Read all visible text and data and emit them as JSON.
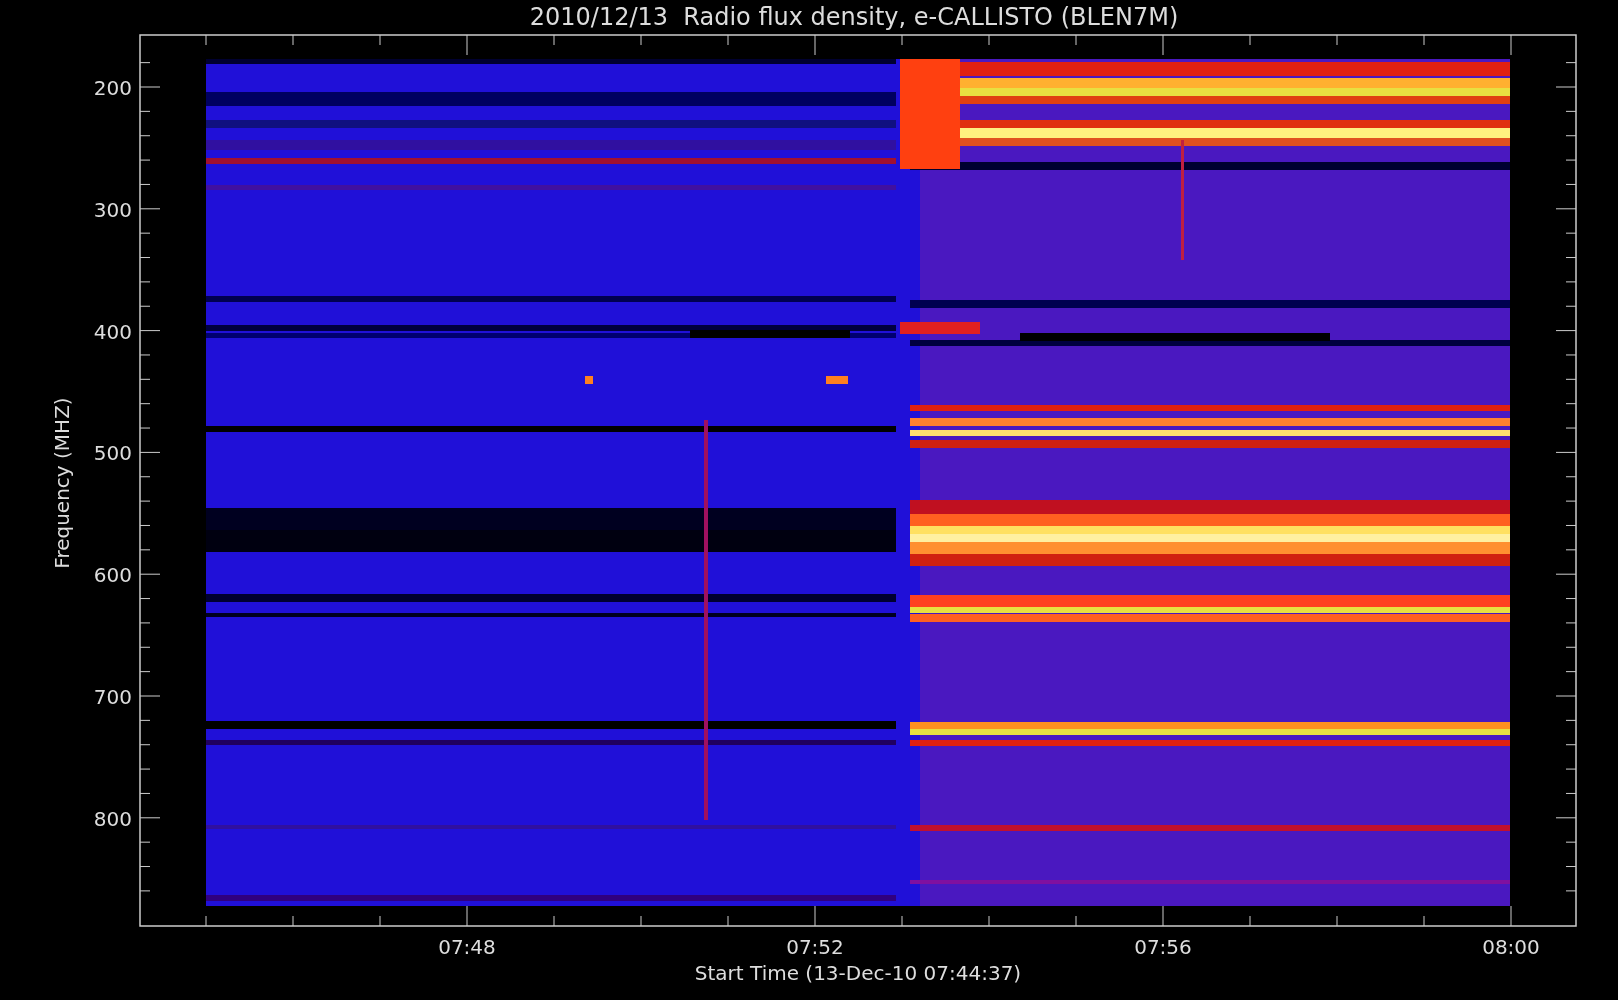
{
  "title": "2010/12/13  Radio flux density, e-CALLISTO (BLEN7M)",
  "y_axis": {
    "label": "Frequency (MHZ)",
    "ticks": [
      "200",
      "300",
      "400",
      "500",
      "600",
      "700",
      "800"
    ]
  },
  "x_axis": {
    "label": "Start Time (13-Dec-10 07:44:37)",
    "ticks": [
      "07:48",
      "07:52",
      "07:56",
      "08:00"
    ]
  }
}
